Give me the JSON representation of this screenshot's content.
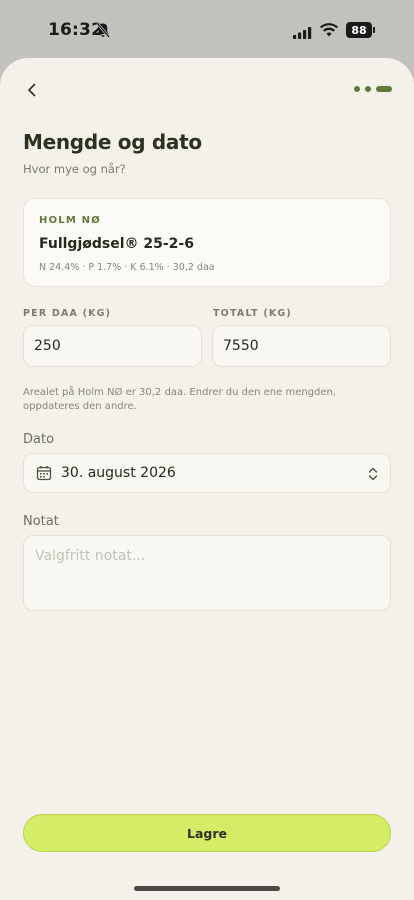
{
  "status_bar": {
    "time": "16:32",
    "battery": "88"
  },
  "header": {
    "title": "Mengde og dato",
    "subtitle": "Hvor mye og når?"
  },
  "product": {
    "field_name": "HOLM NØ",
    "name": "Fullgjødsel® 25-2-6",
    "meta": "N 24.4% · P 1.7% · K 6.1% · 30,2 daa"
  },
  "amounts": {
    "per_daa_label": "PER DAA (KG)",
    "per_daa_value": "250",
    "total_label": "TOTALT (KG)",
    "total_value": "7550",
    "hint": "Arealet på Holm NØ er 30,2 daa. Endrer du den ene mengden, oppdateres den andre."
  },
  "date": {
    "label": "Dato",
    "value": "30. august 2026"
  },
  "note": {
    "label": "Notat",
    "placeholder": "Valgfritt notat..."
  },
  "actions": {
    "save_label": "Lagre"
  },
  "icons": [
    "bell-off-icon",
    "signal-icon",
    "wifi-icon",
    "battery-icon",
    "back-chevron-icon",
    "calendar-icon",
    "updown-chevron-icon"
  ],
  "colors": {
    "accent": "#5f7a3a",
    "button": "#d4ec66",
    "background": "#f3f1ea"
  }
}
